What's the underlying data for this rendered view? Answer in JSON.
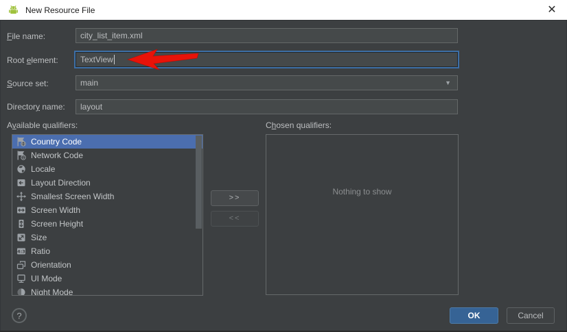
{
  "window": {
    "title": "New Resource File",
    "icons": {
      "app": "android-logo",
      "close": "✕",
      "combo_arrow": "▼"
    }
  },
  "form": {
    "fields": [
      {
        "id": "file-name",
        "label": "File name:",
        "mnemonic_index": 0,
        "value": "city_list_item.xml"
      },
      {
        "id": "root-element",
        "label": "Root element:",
        "mnemonic_index": 5,
        "value": "TextView",
        "focused": true
      },
      {
        "id": "source-set",
        "label": "Source set:",
        "mnemonic_index": 0,
        "value": "main"
      },
      {
        "id": "directory-name",
        "label": "Directory name:",
        "mnemonic_index": 8,
        "value": "layout"
      }
    ]
  },
  "qualifiers": {
    "available": {
      "label": "Available qualifiers:",
      "mnemonic_index": 1,
      "items": [
        {
          "icon": "country-code",
          "label": "Country Code",
          "selected": true
        },
        {
          "icon": "network-code",
          "label": "Network Code",
          "selected": false
        },
        {
          "icon": "locale",
          "label": "Locale",
          "selected": false
        },
        {
          "icon": "layout-direction",
          "label": "Layout Direction",
          "selected": false
        },
        {
          "icon": "smallest-screen-width",
          "label": "Smallest Screen Width",
          "selected": false
        },
        {
          "icon": "screen-width",
          "label": "Screen Width",
          "selected": false
        },
        {
          "icon": "screen-height",
          "label": "Screen Height",
          "selected": false
        },
        {
          "icon": "size",
          "label": "Size",
          "selected": false
        },
        {
          "icon": "ratio",
          "label": "Ratio",
          "selected": false
        },
        {
          "icon": "orientation",
          "label": "Orientation",
          "selected": false
        },
        {
          "icon": "ui-mode",
          "label": "UI Mode",
          "selected": false
        },
        {
          "icon": "night-mode",
          "label": "Night Mode",
          "selected": false
        }
      ]
    },
    "chosen": {
      "label": "Chosen qualifiers:",
      "mnemonic_index": 1,
      "empty_text": "Nothing to show"
    },
    "move_right_label": ">>",
    "move_left_label": "<<"
  },
  "footer": {
    "help_label": "?",
    "ok_label": "OK",
    "cancel_label": "Cancel"
  },
  "colors": {
    "selection": "#4b6eaf",
    "ok_button": "#366395",
    "focus_border": "#3d6fa6",
    "annotation_arrow": "#e81309",
    "android_green": "#a0c23d",
    "titlebar_bg": "#ffffff",
    "dialog_bg": "#3c3f41"
  }
}
